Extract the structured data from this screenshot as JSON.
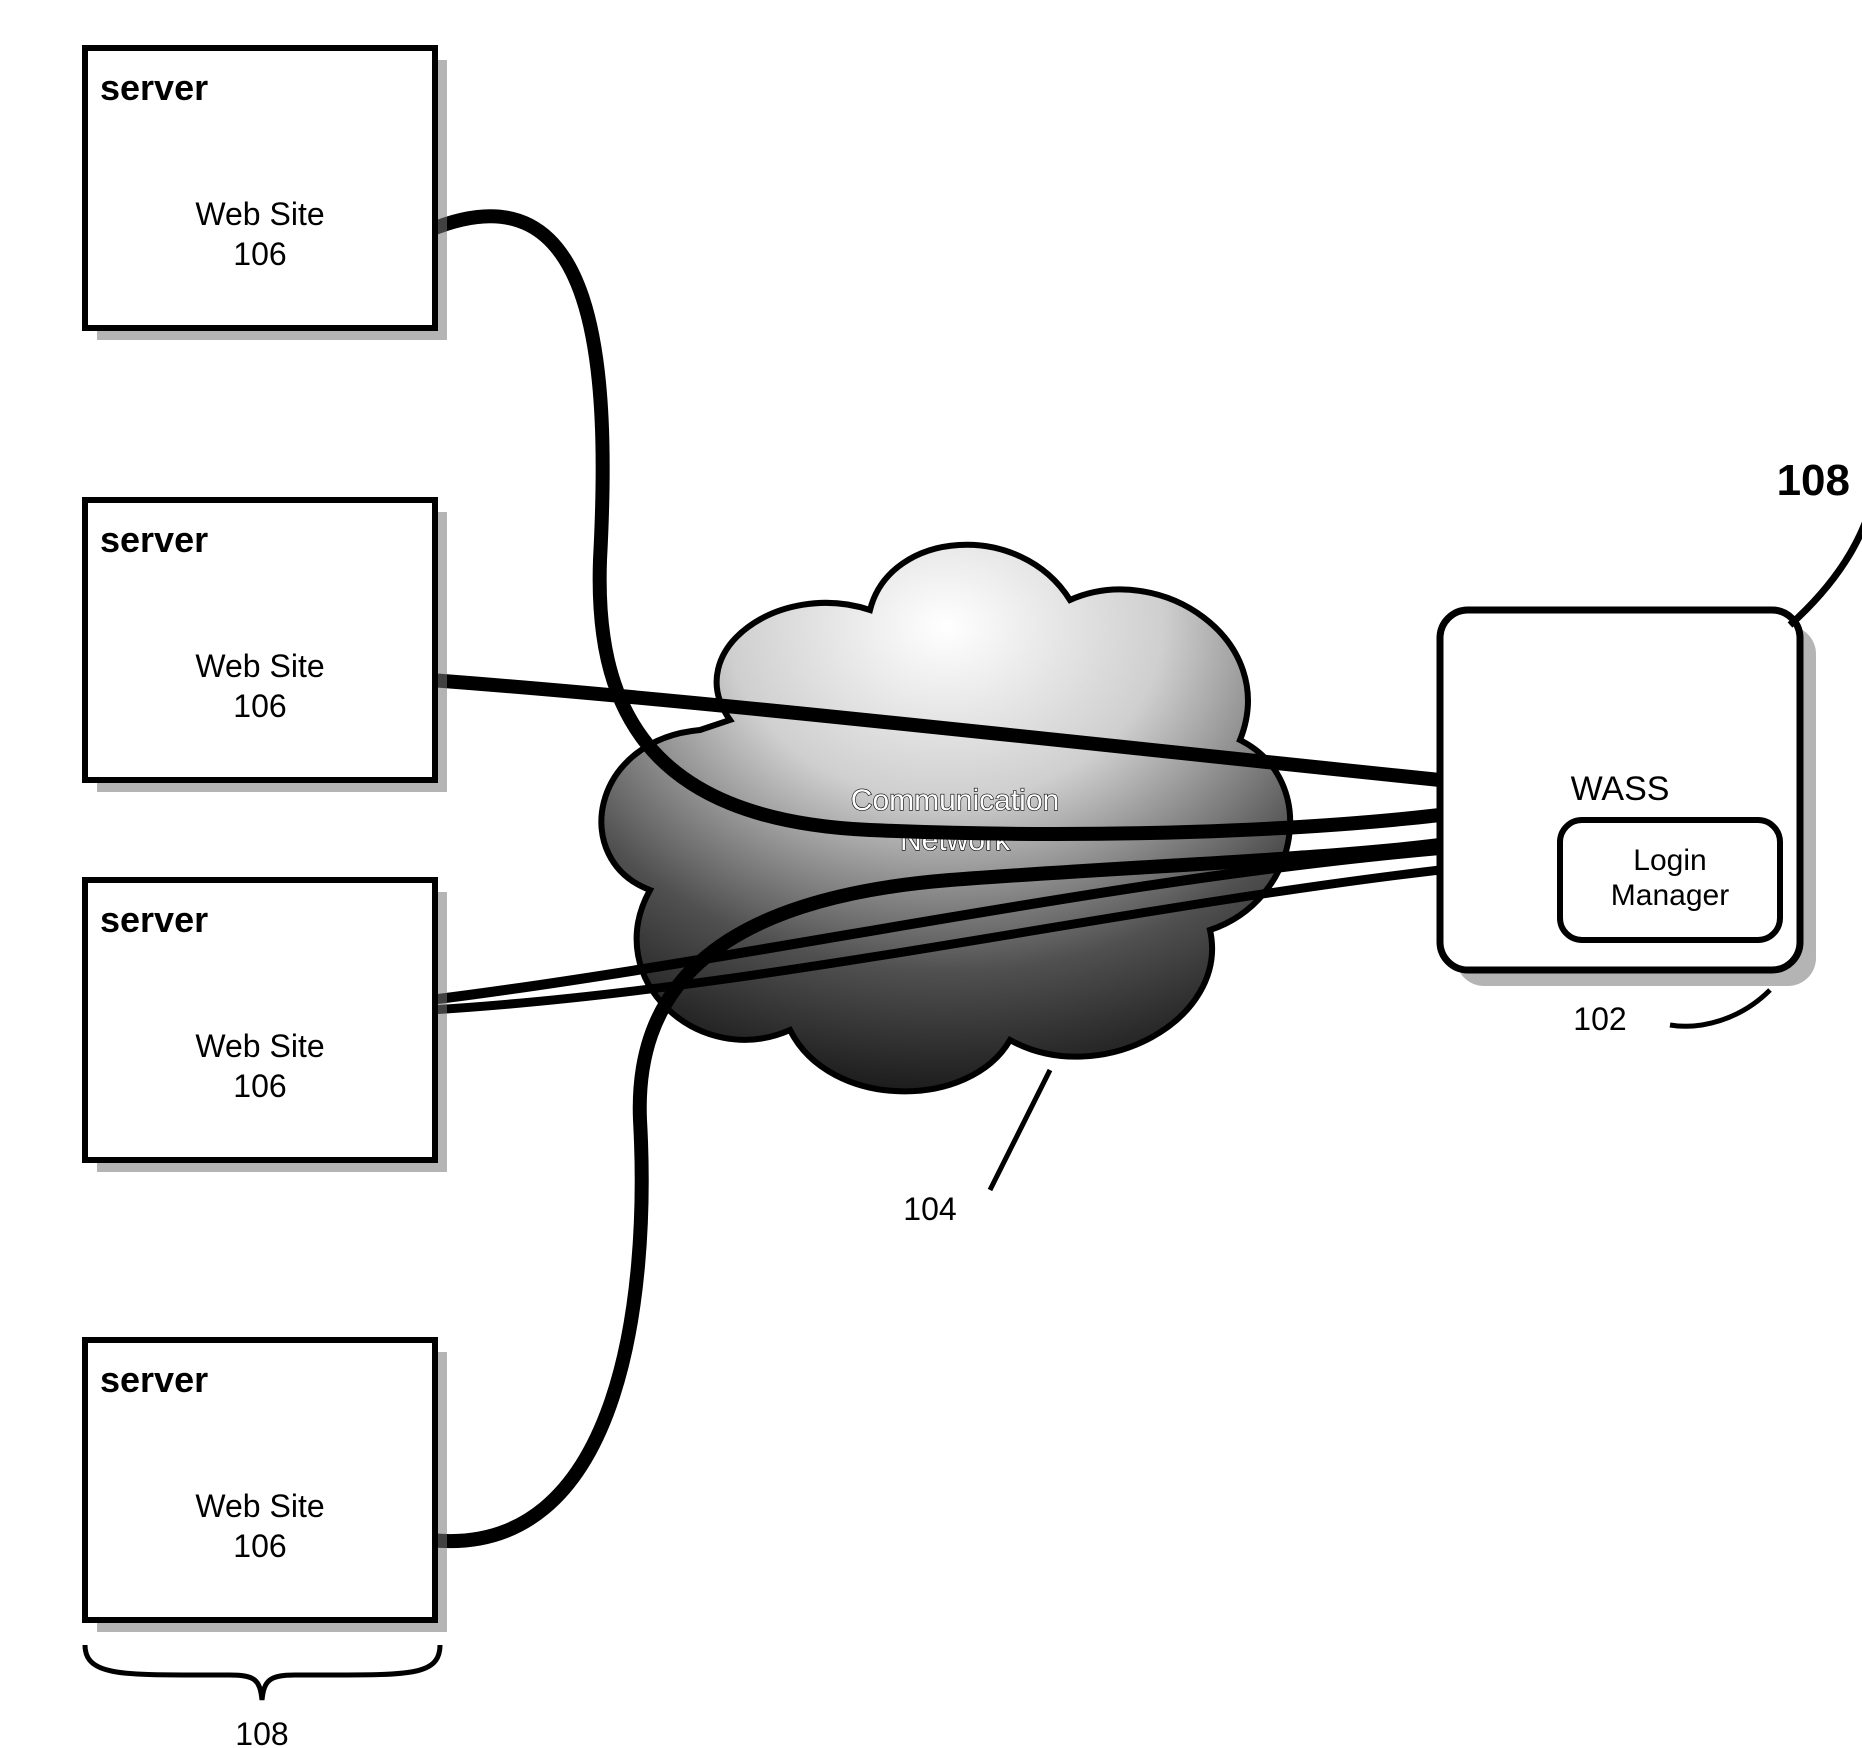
{
  "servers": [
    {
      "title": "server",
      "site_label": "Web Site",
      "site_ref": "106"
    },
    {
      "title": "server",
      "site_label": "Web Site",
      "site_ref": "106"
    },
    {
      "title": "server",
      "site_label": "Web Site",
      "site_ref": "106"
    },
    {
      "title": "server",
      "site_label": "Web Site",
      "site_ref": "106"
    }
  ],
  "servers_group_ref": "108",
  "cloud": {
    "label_line1": "Communication",
    "label_line2": "Network",
    "ref": "104"
  },
  "wass": {
    "title": "WASS",
    "login_line1": "Login",
    "login_line2": "Manager",
    "ref": "102",
    "callout_ref": "108"
  }
}
